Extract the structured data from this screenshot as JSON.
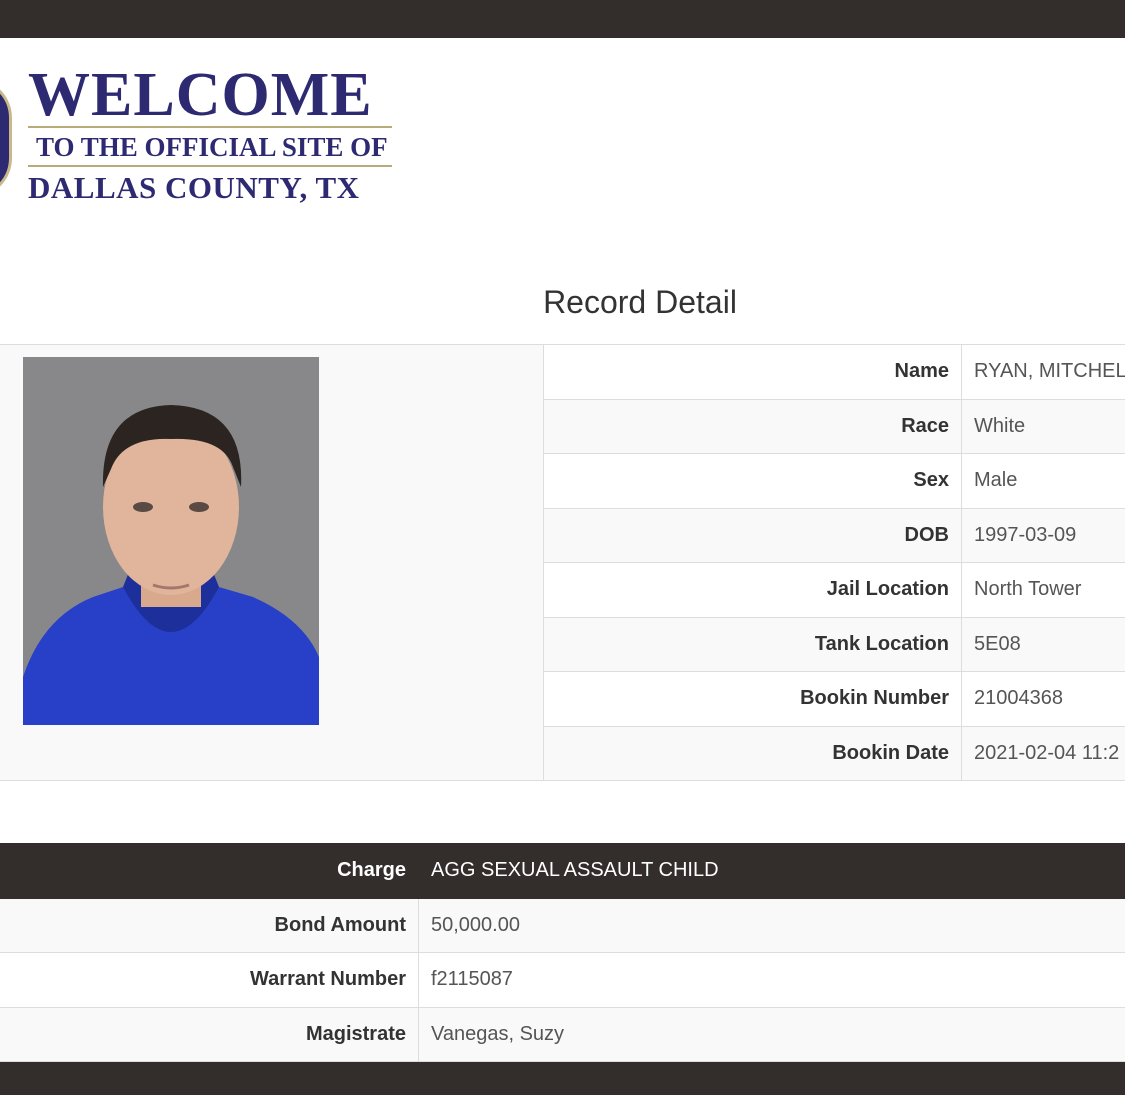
{
  "header": {
    "welcome": "WELCOME",
    "line1": "TO THE OFFICIAL SITE OF",
    "line2": "DALLAS COUNTY, TX"
  },
  "page": {
    "title": "Record Detail"
  },
  "record": [
    {
      "label": "Name",
      "value": "RYAN, MITCHEL"
    },
    {
      "label": "Race",
      "value": "White"
    },
    {
      "label": "Sex",
      "value": "Male"
    },
    {
      "label": "DOB",
      "value": "1997-03-09"
    },
    {
      "label": "Jail Location",
      "value": "North Tower"
    },
    {
      "label": "Tank Location",
      "value": "5E08"
    },
    {
      "label": "Bookin Number",
      "value": "21004368"
    },
    {
      "label": "Bookin Date",
      "value": "2021-02-04 11:2"
    }
  ],
  "charge": [
    {
      "label": "Charge",
      "value": "AGG SEXUAL ASSAULT CHILD"
    },
    {
      "label": "Bond Amount",
      "value": "50,000.00"
    },
    {
      "label": "Warrant Number",
      "value": "f2115087"
    },
    {
      "label": "Magistrate",
      "value": "Vanegas, Suzy"
    }
  ],
  "colors": {
    "brand": "#2e2a72",
    "bar": "#332d2c",
    "gold": "#b9aa7a"
  }
}
